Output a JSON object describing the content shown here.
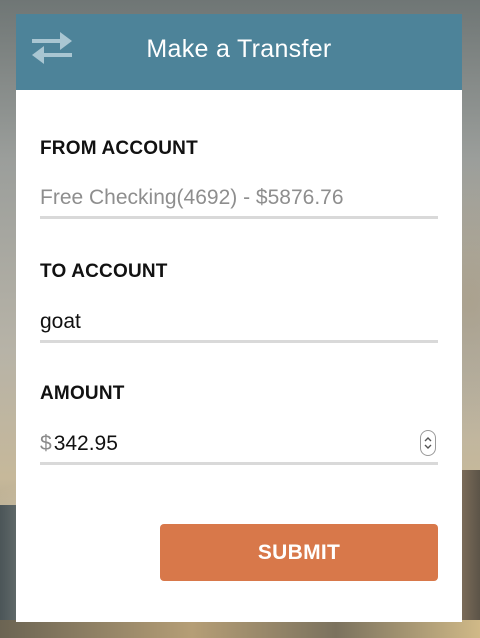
{
  "header": {
    "title": "Make a Transfer",
    "icon": "transfer-arrows-icon"
  },
  "from_account": {
    "label": "FROM ACCOUNT",
    "value": "Free Checking(4692) - $5876.76"
  },
  "to_account": {
    "label": "TO ACCOUNT",
    "value": "goat"
  },
  "amount": {
    "label": "AMOUNT",
    "currency_symbol": "$",
    "value": "342.95"
  },
  "submit": {
    "label": "SUBMIT"
  },
  "colors": {
    "header_bg": "#4d8399",
    "submit_bg": "#d8784a",
    "underline": "#d9d9d9"
  }
}
